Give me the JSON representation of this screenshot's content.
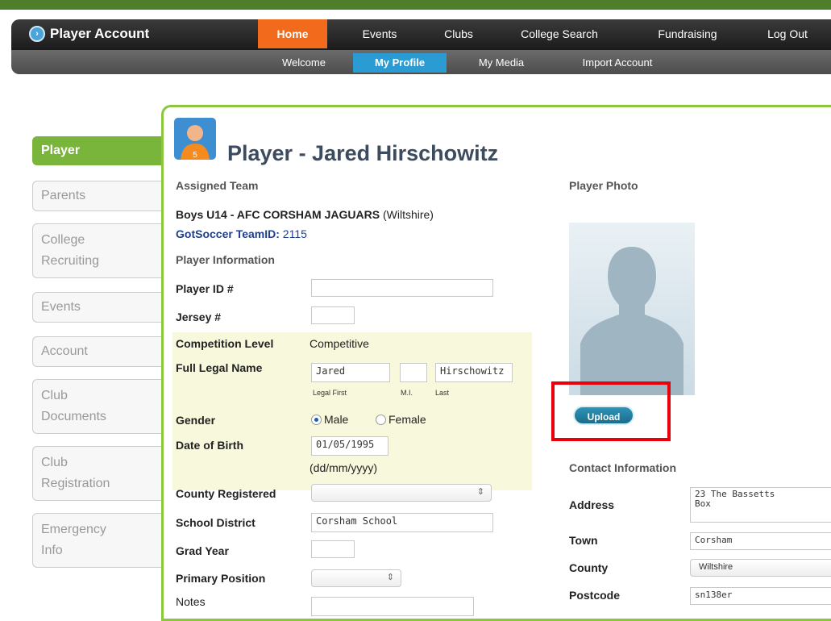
{
  "header": {
    "brand": "Player Account",
    "nav": [
      "Home",
      "Events",
      "Clubs",
      "College Search",
      "Fundraising",
      "Log Out"
    ],
    "active_nav": "Home",
    "subnav": [
      "Welcome",
      "My Profile",
      "My Media",
      "Import Account"
    ],
    "active_subnav": "My Profile"
  },
  "sidebar": {
    "tabs": [
      {
        "lines": [
          "Player"
        ]
      },
      {
        "lines": [
          "Parents"
        ]
      },
      {
        "lines": [
          "College",
          "Recruiting"
        ]
      },
      {
        "lines": [
          "Events"
        ]
      },
      {
        "lines": [
          "Account"
        ]
      },
      {
        "lines": [
          "Club",
          "Documents"
        ]
      },
      {
        "lines": [
          "Club",
          "Registration"
        ]
      },
      {
        "lines": [
          "Emergency",
          "Info"
        ]
      }
    ],
    "active": "Player"
  },
  "profile": {
    "title": "Player - Jared Hirschowitz",
    "assigned_team_heading": "Assigned Team",
    "team_name": "Boys U14 - AFC CORSHAM JAGUARS",
    "team_region": "(Wiltshire)",
    "teamid_label": "GotSoccer TeamID:",
    "teamid_value": "2115",
    "player_info_heading": "Player Information",
    "fields": {
      "player_id_label": "Player ID #",
      "player_id_value": "",
      "jersey_label": "Jersey #",
      "jersey_value": "",
      "competition_label": "Competition Level",
      "competition_value": "Competitive",
      "legal_name_label": "Full Legal Name",
      "first_name": "Jared",
      "middle_initial": "",
      "last_name": "Hirschowitz",
      "first_caption": "Legal First",
      "mi_caption": "M.I.",
      "last_caption": "Last",
      "gender_label": "Gender",
      "gender_male": "Male",
      "gender_female": "Female",
      "gender_selected": "Male",
      "dob_label": "Date of Birth",
      "dob_value": "01/05/1995",
      "dob_format": "(dd/mm/yyyy)",
      "county_reg_label": "County Registered",
      "county_reg_value": "",
      "school_label": "School District",
      "school_value": "Corsham School",
      "grad_label": "Grad Year",
      "grad_value": "",
      "position_label": "Primary Position",
      "position_value": "",
      "notes_label": "Notes",
      "notes_value": ""
    }
  },
  "photo": {
    "heading": "Player Photo",
    "upload_label": "Upload"
  },
  "contact": {
    "heading": "Contact Information",
    "address_label": "Address",
    "address_value": "23 The Bassetts\nBox",
    "town_label": "Town",
    "town_value": "Corsham",
    "county_label": "County",
    "county_value": "Wiltshire",
    "postcode_label": "Postcode",
    "postcode_value": "sn138er"
  },
  "colors": {
    "nav_active": "#f26a1b",
    "subnav_active": "#2a9bd3",
    "sidebar_active": "#79b43b",
    "panel_border": "#8cc63f",
    "highlight": "#e8000b"
  }
}
